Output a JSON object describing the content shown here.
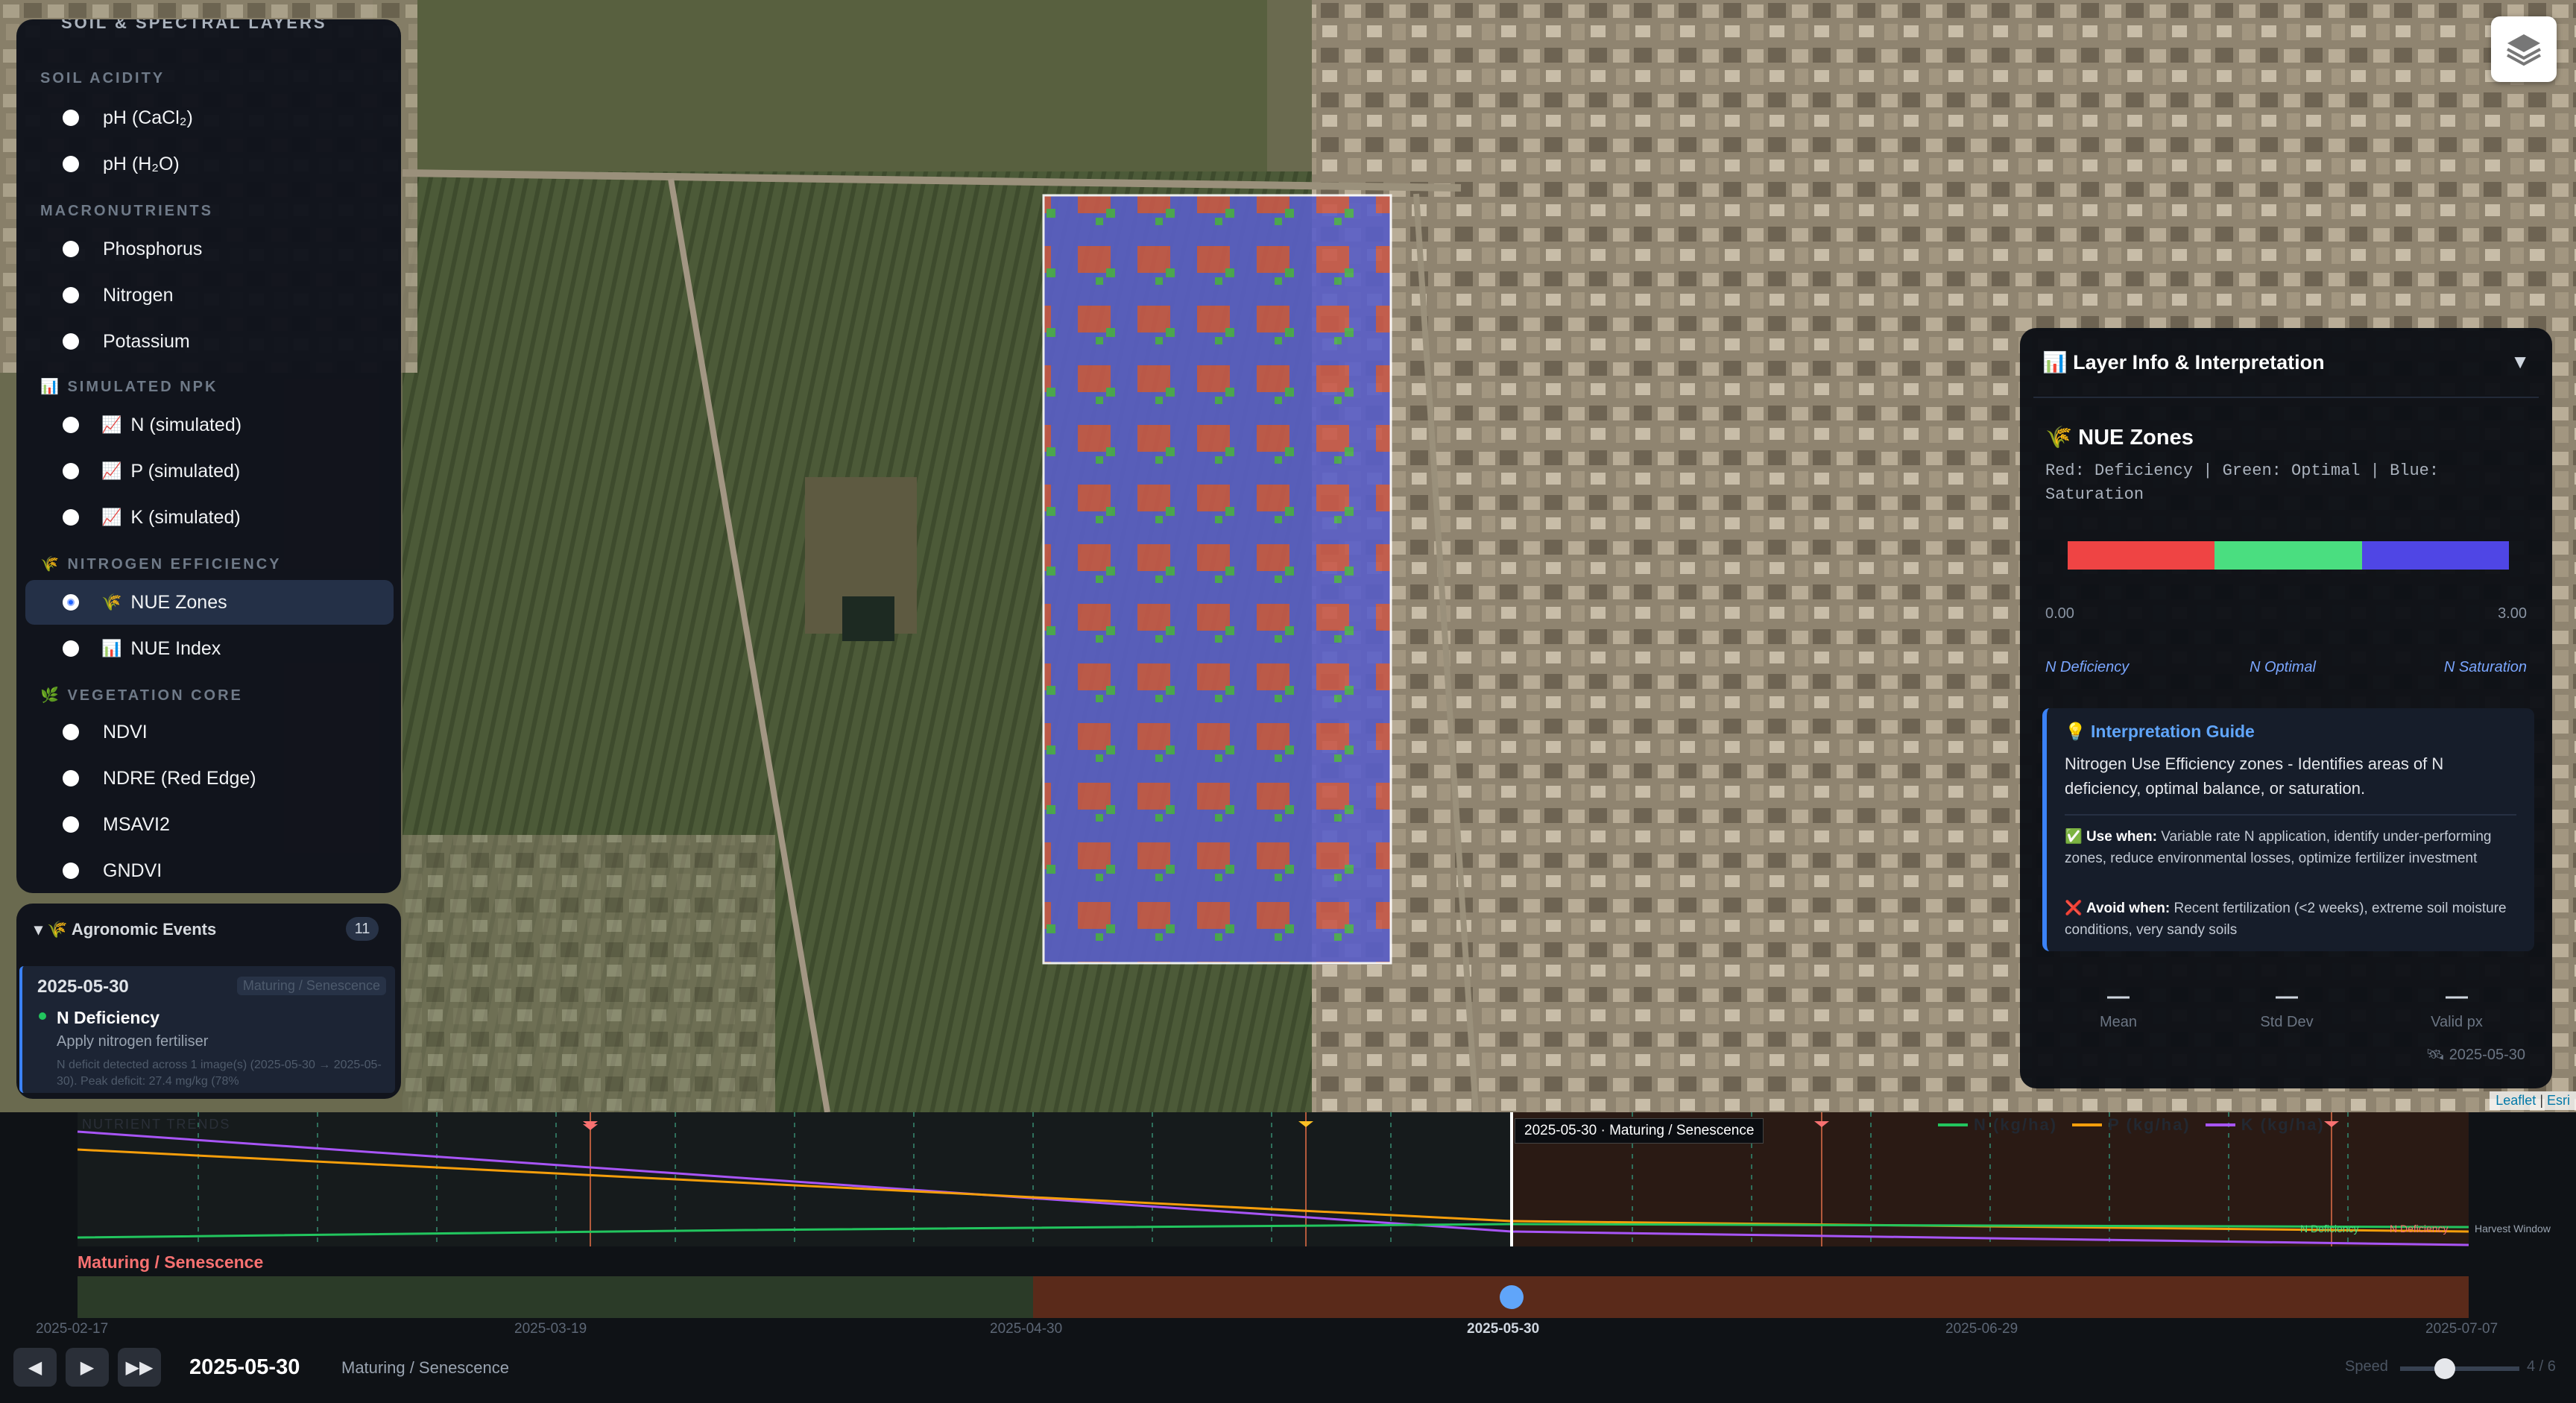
{
  "layers_panel": {
    "title_truncated": "SOIL & SPECTRAL LAYERS",
    "sections": {
      "soil_acidity": "SOIL ACIDITY",
      "macronutrients": "MACRONUTRIENTS",
      "simulated_npk": "SIMULATED NPK",
      "nitrogen_efficiency": "NITROGEN EFFICIENCY",
      "vegetation_core": "VEGETATION CORE"
    },
    "options": {
      "ph_cacl2": "pH (CaCl₂)",
      "ph_h2o": "pH (H₂O)",
      "phosphorus": "Phosphorus",
      "nitrogen": "Nitrogen",
      "potassium": "Potassium",
      "n_sim": "N (simulated)",
      "p_sim": "P (simulated)",
      "k_sim": "K (simulated)",
      "nue_zones": "NUE Zones",
      "nue_index": "NUE Index",
      "ndvi": "NDVI",
      "ndre": "NDRE (Red Edge)",
      "msavi2": "MSAVI2",
      "gndvi": "GNDVI"
    },
    "selected": "NUE Zones"
  },
  "events": {
    "title": "Agronomic Events",
    "count": "11",
    "card": {
      "date": "2025-05-30",
      "stage": "Maturing / Senescence",
      "title": "N Deficiency",
      "subtitle": "Apply nitrogen fertiliser",
      "detail": "N deficit detected across 1 image(s) (2025-05-30 → 2025-05-30). Peak deficit: 27.4 mg/kg (78%"
    }
  },
  "info_panel": {
    "header": "Layer Info & Interpretation",
    "layer_name": "NUE Zones",
    "legend_desc": "Red: Deficiency | Green: Optimal | Blue: Saturation",
    "ramp_colors": [
      "#ef4444",
      "#4ade80",
      "#4f46e5"
    ],
    "range_min": "0.00",
    "range_max": "3.00",
    "range_labels": [
      "N Deficiency",
      "N Optimal",
      "N Saturation"
    ],
    "guide": {
      "title": "Interpretation Guide",
      "text": "Nitrogen Use Efficiency zones - Identifies areas of N deficiency, optimal balance, or saturation.",
      "use_label": "Use when:",
      "use_text": "Variable rate N application, identify under-performing zones, reduce environmental losses, optimize fertilizer investment",
      "avoid_label": "Avoid when:",
      "avoid_text": "Recent fertilization (<2 weeks), extreme soil moisture conditions, very sandy soils"
    },
    "stats": [
      {
        "label": "Mean",
        "value": "—"
      },
      {
        "label": "Std Dev",
        "value": "—"
      },
      {
        "label": "Valid px",
        "value": "—"
      }
    ],
    "date": "2025-05-30"
  },
  "attribution": {
    "leaflet": "Leaflet",
    "sep": " | ",
    "esri": "Esri"
  },
  "timeline": {
    "chart_title": "NUTRIENT TRENDS",
    "tooltip": "2025-05-30 · Maturing / Senescence",
    "legend": [
      "N (kg/ha)",
      "P (kg/ha)",
      "K (kg/ha)"
    ],
    "series_colors": {
      "N": "#22c55e",
      "P": "#f59e0b",
      "K": "#a855f7"
    },
    "marker_labels": [
      "N Deficiency",
      "N Deficiency",
      "Harvest Window"
    ],
    "stage_label": "Maturing / Senescence",
    "ticks": [
      "2025-02-17",
      "2025-03-19",
      "2025-04-30",
      "2025-05-30",
      "2025-06-29",
      "2025-07-07"
    ],
    "current_date": "2025-05-30",
    "current_stage": "Maturing / Senescence",
    "speed_label": "Speed",
    "speed_value": "4 / 6",
    "controls": {
      "prev": "◀",
      "play": "▶",
      "fast": "▶▶"
    }
  }
}
